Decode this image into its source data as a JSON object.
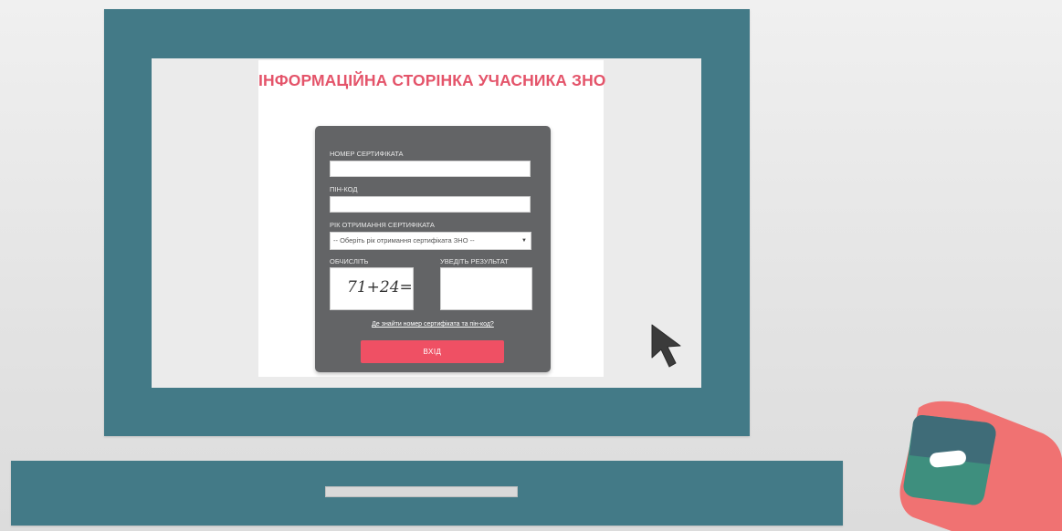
{
  "page": {
    "title": "ІНФОРМАЦІЙНА СТОРІНКА УЧАСНИКА ЗНО"
  },
  "form": {
    "certificate_label": "НОМЕР СЕРТИФІКАТА",
    "certificate_value": "",
    "pin_label": "ПІН-КОД",
    "pin_value": "",
    "year_label": "РІК ОТРИМАННЯ СЕРТИФІКАТА",
    "year_selected": "-- Оберіть рік отримання сертифіката ЗНО --",
    "captcha_label": "ОБЧИСЛІТЬ",
    "captcha_expression": "71+24=",
    "result_label": "УВЕДІТЬ РЕЗУЛЬТАТ",
    "result_value": "",
    "help_link": "Де знайти номер сертифіката та пін-код?",
    "submit_label": "ВХІД"
  },
  "icons": {
    "cursor": "mouse-pointer-icon",
    "logo": "app-logo-icon",
    "select_arrow": "dropdown-arrow-icon"
  },
  "colors": {
    "frame": "#437a87",
    "accent": "#ef5064",
    "title": "#e4546a",
    "card": "#636466"
  }
}
